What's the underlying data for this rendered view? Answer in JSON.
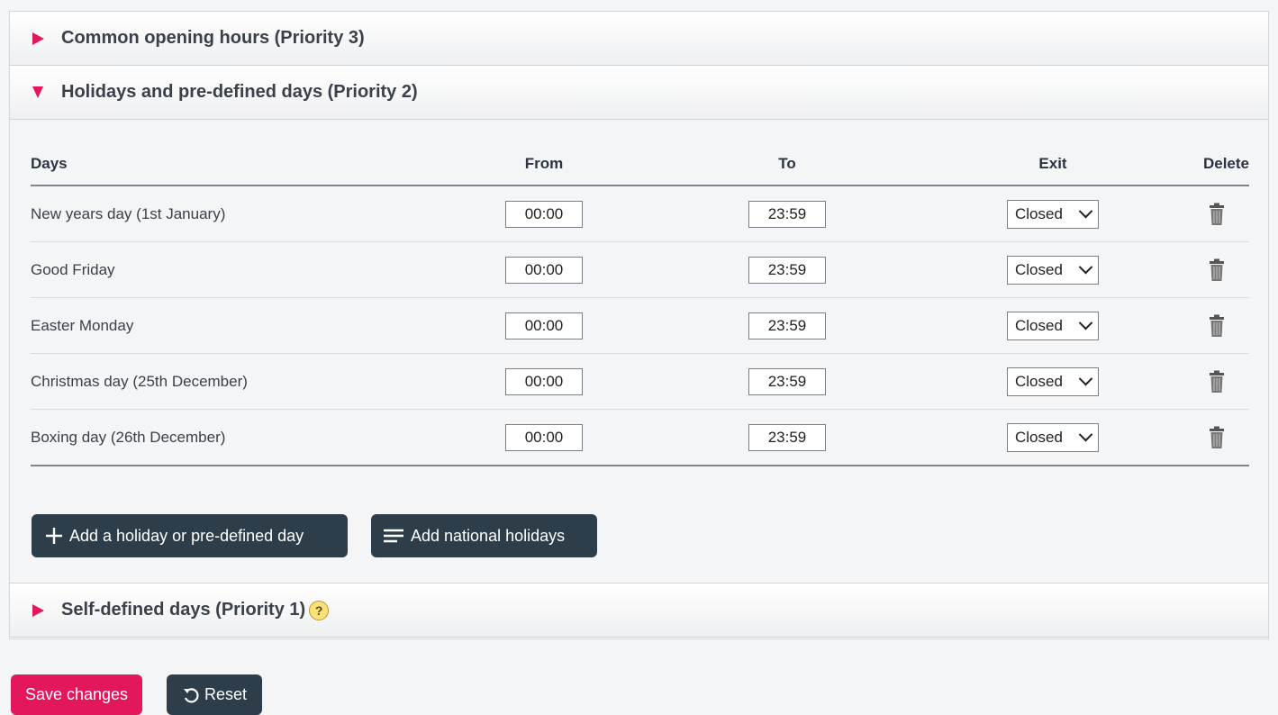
{
  "sections": {
    "common": {
      "title": "Common opening hours (Priority 3)"
    },
    "holidays": {
      "title": "Holidays and pre-defined days (Priority 2)"
    },
    "self_defined": {
      "title": "Self-defined days (Priority 1)",
      "help": "?"
    }
  },
  "table": {
    "headers": {
      "days": "Days",
      "from": "From",
      "to": "To",
      "exit": "Exit",
      "delete": "Delete"
    },
    "rows": [
      {
        "day": "New years day (1st January)",
        "from": "00:00",
        "to": "23:59",
        "exit": "Closed"
      },
      {
        "day": "Good Friday",
        "from": "00:00",
        "to": "23:59",
        "exit": "Closed"
      },
      {
        "day": "Easter Monday",
        "from": "00:00",
        "to": "23:59",
        "exit": "Closed"
      },
      {
        "day": "Christmas day (25th December)",
        "from": "00:00",
        "to": "23:59",
        "exit": "Closed"
      },
      {
        "day": "Boxing day (26th December)",
        "from": "00:00",
        "to": "23:59",
        "exit": "Closed"
      }
    ]
  },
  "actions": {
    "add_holiday": "Add a holiday or pre-defined day",
    "add_national": "Add national holidays",
    "save": "Save changes",
    "reset": "Reset"
  },
  "colors": {
    "accent": "#e2175c",
    "button_dark": "#2e3d4a"
  }
}
